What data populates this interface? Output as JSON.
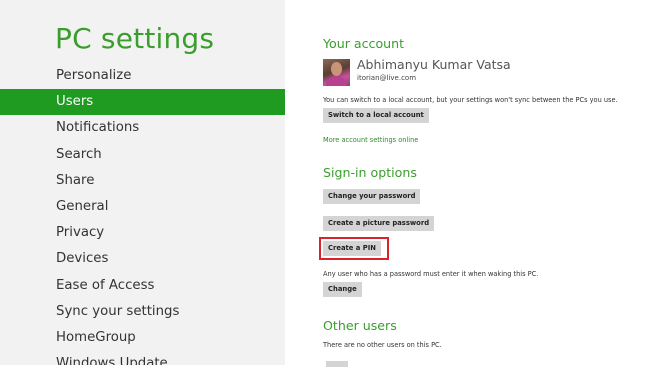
{
  "app": {
    "title": "PC settings"
  },
  "sidebar": {
    "items": [
      {
        "label": "Personalize",
        "active": false
      },
      {
        "label": "Users",
        "active": true
      },
      {
        "label": "Notifications",
        "active": false
      },
      {
        "label": "Search",
        "active": false
      },
      {
        "label": "Share",
        "active": false
      },
      {
        "label": "General",
        "active": false
      },
      {
        "label": "Privacy",
        "active": false
      },
      {
        "label": "Devices",
        "active": false
      },
      {
        "label": "Ease of Access",
        "active": false
      },
      {
        "label": "Sync your settings",
        "active": false
      },
      {
        "label": "HomeGroup",
        "active": false
      },
      {
        "label": "Windows Update",
        "active": false
      }
    ]
  },
  "account": {
    "heading": "Your account",
    "name": "Abhimanyu Kumar Vatsa",
    "email": "itorian@live.com",
    "local_note": "You can switch to a local account, but your settings won't sync between the PCs you use.",
    "switch_button": "Switch to a local account",
    "more_link": "More account settings online"
  },
  "signin": {
    "heading": "Sign-in options",
    "change_password_button": "Change your password",
    "picture_password_button": "Create a picture password",
    "create_pin_button": "Create a PIN",
    "wake_note": "Any user who has a password must enter it when waking this PC.",
    "change_button": "Change"
  },
  "other_users": {
    "heading": "Other users",
    "note": "There are no other users on this PC."
  },
  "colors": {
    "accent": "#3a9e2c",
    "active_nav": "#1f9b21",
    "highlight": "#d8242c",
    "sidebar_bg": "#f2f2f2"
  }
}
